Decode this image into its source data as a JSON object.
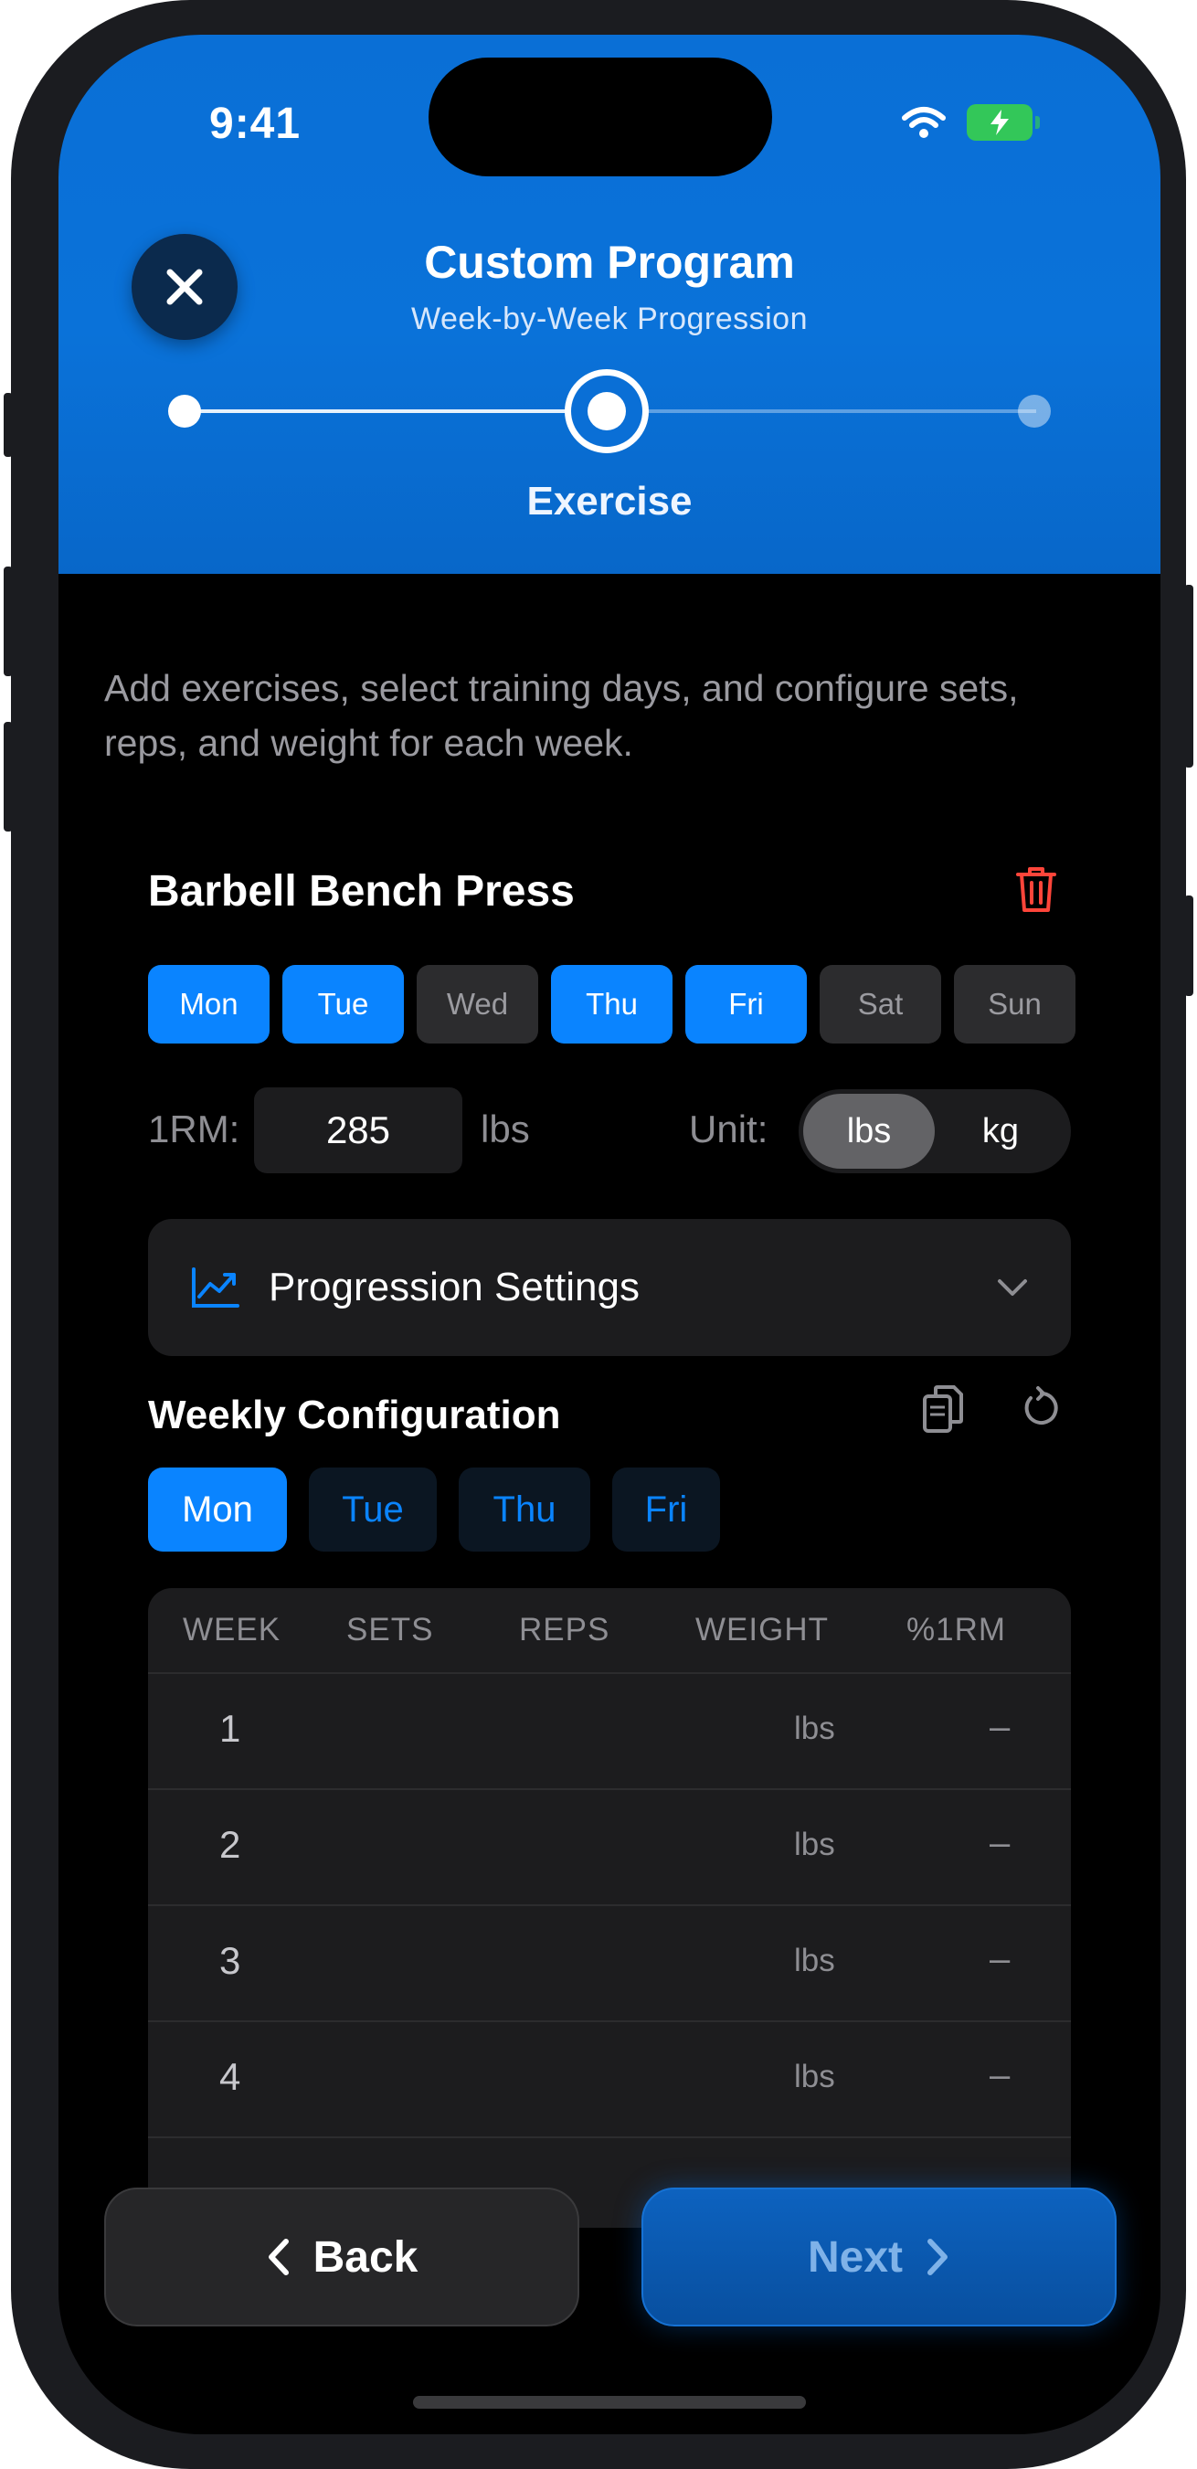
{
  "status": {
    "time": "9:41"
  },
  "header": {
    "title": "Custom Program",
    "subtitle": "Week-by-Week Progression",
    "step_label": "Exercise"
  },
  "intro": "Add exercises, select training days, and configure sets, reps, and weight for each week.",
  "exercise": {
    "name": "Barbell Bench Press",
    "days": [
      {
        "label": "Mon",
        "selected": true
      },
      {
        "label": "Tue",
        "selected": true
      },
      {
        "label": "Wed",
        "selected": false
      },
      {
        "label": "Thu",
        "selected": true
      },
      {
        "label": "Fri",
        "selected": true
      },
      {
        "label": "Sat",
        "selected": false
      },
      {
        "label": "Sun",
        "selected": false
      }
    ],
    "orm_label": "1RM:",
    "orm_value": "285",
    "orm_unit": "lbs",
    "unit_label": "Unit:",
    "unit_options": [
      "lbs",
      "kg"
    ],
    "unit_selected": "lbs"
  },
  "progression": {
    "label": "Progression Settings"
  },
  "weekly": {
    "title": "Weekly Configuration",
    "tabs": [
      "Mon",
      "Tue",
      "Thu",
      "Fri"
    ],
    "active_tab": "Mon",
    "columns": [
      "WEEK",
      "SETS",
      "REPS",
      "WEIGHT",
      "%1RM"
    ],
    "rows": [
      {
        "week": "1",
        "unit": "lbs",
        "pct": "–"
      },
      {
        "week": "2",
        "unit": "lbs",
        "pct": "–"
      },
      {
        "week": "3",
        "unit": "lbs",
        "pct": "–"
      },
      {
        "week": "4",
        "unit": "lbs",
        "pct": "–"
      }
    ]
  },
  "footer": {
    "back_label": "Back",
    "next_label": "Next"
  },
  "colors": {
    "accent": "#0a84ff",
    "header": "#0a6fd6",
    "danger": "#ff453a"
  }
}
